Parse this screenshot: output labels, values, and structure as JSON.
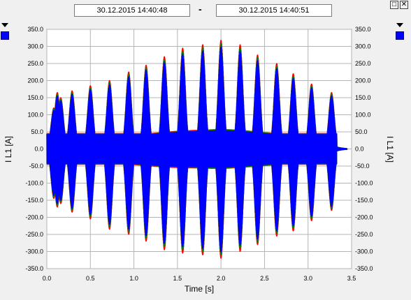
{
  "header": {
    "start_time": "30.12.2015     14:40:48",
    "separator": "-",
    "end_time": "30.12.2015     14:40:51",
    "maximize_glyph": "□",
    "close_glyph": "✕"
  },
  "icons": {
    "legend_arrow": "triangle-down-icon",
    "legend_swatch": "blue-square-icon"
  },
  "colors": {
    "series_1": "#ff0000",
    "series_2": "#008000",
    "series_3": "#0000ff"
  },
  "chart_data": {
    "type": "line",
    "title": "",
    "xlabel": "Time [s]",
    "ylabel": "I L1 [A]",
    "ylabel_right": "I L1 [A]",
    "xlim": [
      0.0,
      3.5
    ],
    "ylim": [
      -350.0,
      350.0
    ],
    "grid": true,
    "x_ticks": [
      "0.0",
      "0.5",
      "1.0",
      "1.5",
      "2.0",
      "2.5",
      "3.0",
      "3.5"
    ],
    "y_ticks": [
      "350.0",
      "300.0",
      "250.0",
      "200.0",
      "150.0",
      "100.0",
      "50.0",
      "0.0",
      "-50.0",
      "-100.0",
      "-150.0",
      "-200.0",
      "-250.0",
      "-300.0",
      "-350.0"
    ],
    "signal_end_s": 3.33,
    "envelope_peaks": {
      "t": [
        0.08,
        0.12,
        0.16,
        0.29,
        0.5,
        0.72,
        0.94,
        1.14,
        1.35,
        1.56,
        1.79,
        2.0,
        2.22,
        2.42,
        2.64,
        2.83,
        3.04,
        3.27
      ],
      "positive": [
        120,
        165,
        150,
        170,
        185,
        200,
        225,
        245,
        270,
        295,
        305,
        318,
        305,
        275,
        250,
        220,
        190,
        165
      ],
      "negative": [
        -145,
        -170,
        -160,
        -185,
        -205,
        -235,
        -250,
        -270,
        -295,
        -305,
        -310,
        -320,
        -300,
        -280,
        -255,
        -240,
        -210,
        -180
      ]
    },
    "series": [
      {
        "color": "#ff0000"
      },
      {
        "color": "#008000"
      },
      {
        "color": "#0000ff"
      }
    ]
  }
}
